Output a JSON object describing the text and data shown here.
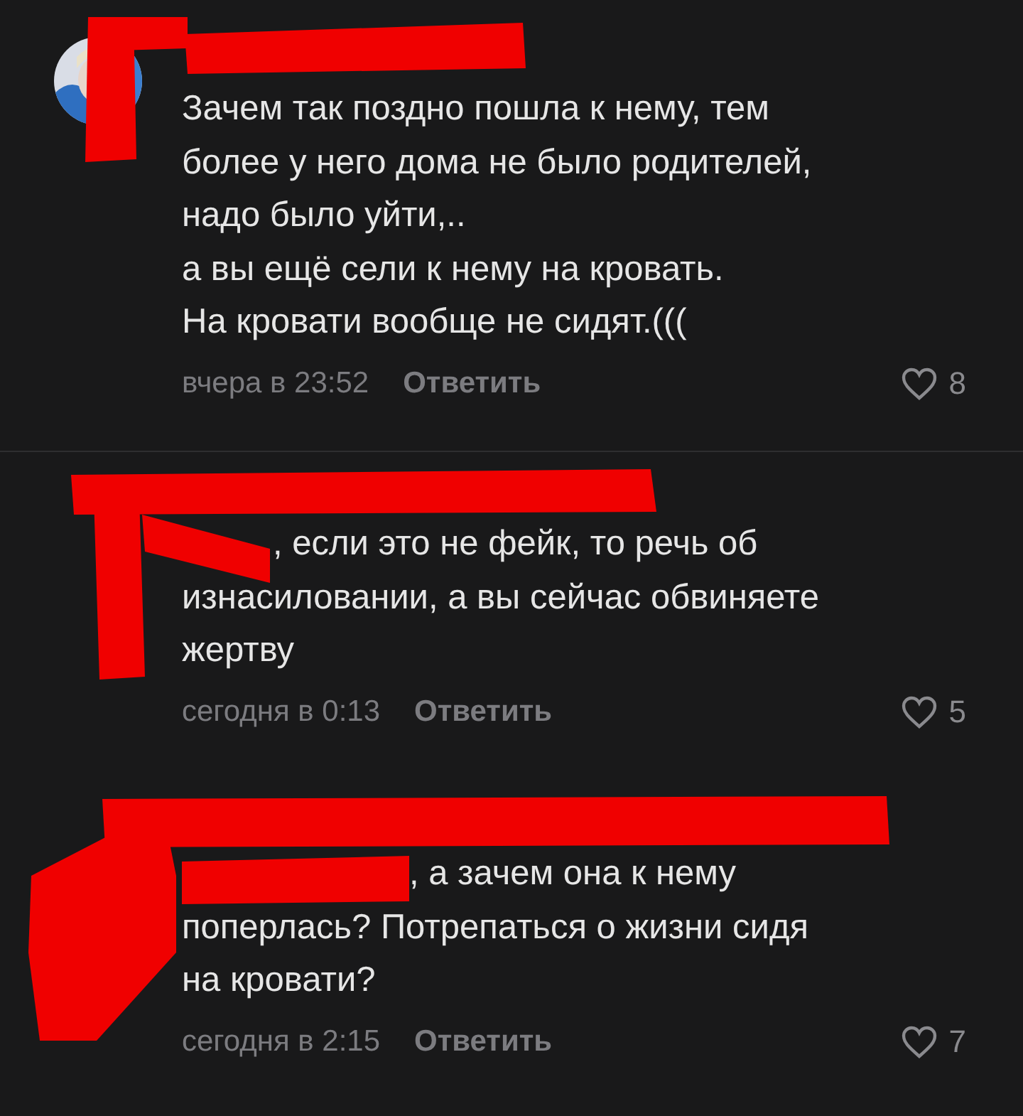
{
  "comments": [
    {
      "avatar_photo": true,
      "name_redacted": true,
      "reply_redacted": false,
      "divider_after": true,
      "text": "Зачем так поздно пошла к нему, тем\nболее у него дома не было родителей,\nнадо было уйти,..\nа вы ещё сели к нему на кровать.\nНа кровати вообще не сидят.(((",
      "time": "вчера в 23:52",
      "reply": "Ответить",
      "likes": "8"
    },
    {
      "avatar_photo": false,
      "name_redacted": true,
      "reply_redacted": true,
      "divider_after": false,
      "text": ", если это не фейк, то речь об\nизнасиловании, а вы сейчас обвиняете\nжертву",
      "time": "сегодня в 0:13",
      "reply": "Ответить",
      "likes": "5"
    },
    {
      "avatar_photo": false,
      "name_redacted": true,
      "reply_redacted": true,
      "divider_after": false,
      "text": ", а зачем она к нему\nпоперлась? Потрепаться о жизни сидя\nна кровати?",
      "time": "сегодня в 2:15",
      "reply": "Ответить",
      "likes": "7"
    }
  ]
}
